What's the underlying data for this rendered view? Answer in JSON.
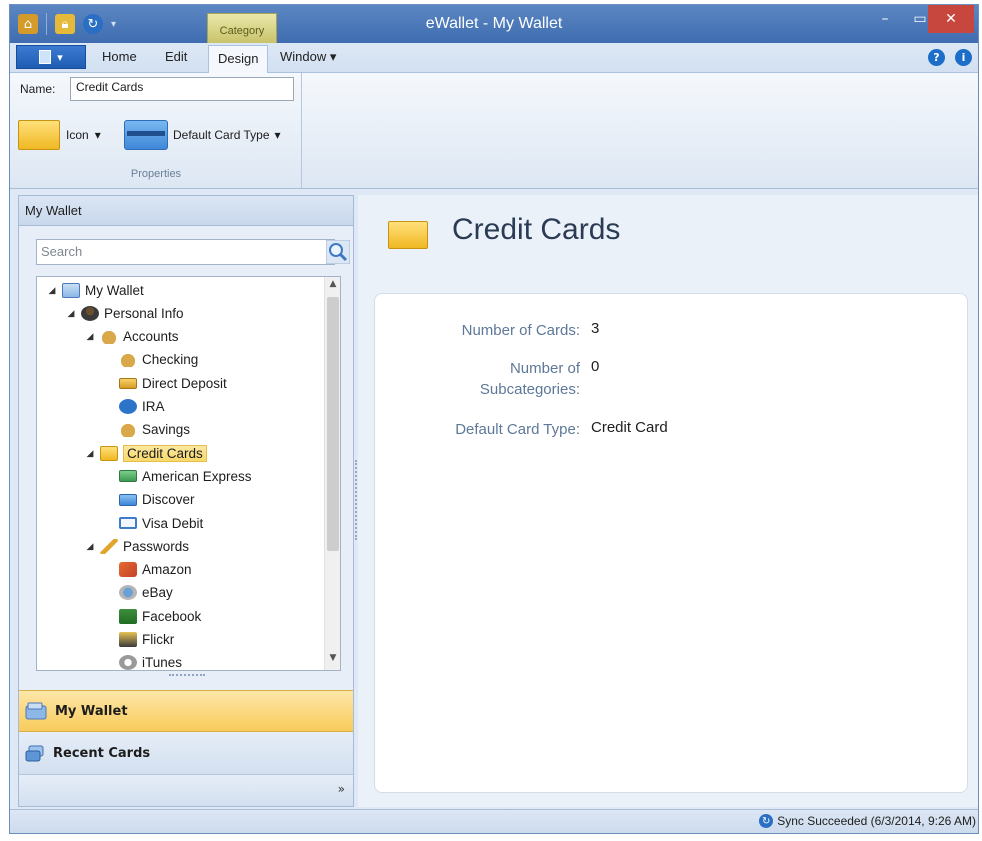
{
  "window": {
    "title": "eWallet - My Wallet",
    "context_tab": "Category"
  },
  "menu": {
    "tabs": [
      "Home",
      "Edit",
      "Design",
      "Window"
    ],
    "active_tab": "Design",
    "window_dropdown": "▾"
  },
  "ribbon": {
    "name_label": "Name:",
    "name_value": "Credit Cards",
    "icon_button": "Icon",
    "default_card_type_button": "Default Card Type",
    "group_label": "Properties"
  },
  "left_pane": {
    "header": "My Wallet",
    "search_placeholder": "Search",
    "tree": [
      {
        "label": "My Wallet",
        "icon": "wallet-icon",
        "level": 0,
        "expanded": true
      },
      {
        "label": "Personal Info",
        "icon": "person-icon",
        "level": 1,
        "expanded": true
      },
      {
        "label": "Accounts",
        "icon": "money-bag-icon",
        "level": 2,
        "expanded": true
      },
      {
        "label": "Checking",
        "icon": "money-bag-icon",
        "level": 3
      },
      {
        "label": "Direct Deposit",
        "icon": "check-icon",
        "level": 3
      },
      {
        "label": "IRA",
        "icon": "info-icon",
        "level": 3
      },
      {
        "label": "Savings",
        "icon": "money-bag-icon",
        "level": 3
      },
      {
        "label": "Credit Cards",
        "icon": "folder-icon",
        "level": 2,
        "expanded": true,
        "selected": true
      },
      {
        "label": "American Express",
        "icon": "credit-card-green-icon",
        "level": 3
      },
      {
        "label": "Discover",
        "icon": "credit-card-blue-icon",
        "level": 3
      },
      {
        "label": "Visa Debit",
        "icon": "credit-card-white-icon",
        "level": 3
      },
      {
        "label": "Passwords",
        "icon": "key-icon",
        "level": 2,
        "expanded": true
      },
      {
        "label": "Amazon",
        "icon": "amazon-icon",
        "level": 3
      },
      {
        "label": "eBay",
        "icon": "ebay-icon",
        "level": 3
      },
      {
        "label": "Facebook",
        "icon": "facebook-icon",
        "level": 3
      },
      {
        "label": "Flickr",
        "icon": "flickr-icon",
        "level": 3
      },
      {
        "label": "iTunes",
        "icon": "itunes-icon",
        "level": 3
      }
    ],
    "nav_buttons": [
      "My Wallet",
      "Recent Cards"
    ]
  },
  "right_pane": {
    "title": "Credit Cards",
    "properties": [
      {
        "label": "Number of Cards:",
        "value": "3"
      },
      {
        "label": "Number of Subcategories:",
        "label_line1": "Number of",
        "label_line2": "Subcategories:",
        "value": "0"
      },
      {
        "label": "Default Card Type:",
        "value": "Credit Card"
      }
    ]
  },
  "status": {
    "text": "Sync Succeeded (6/3/2014, 9:26 AM)"
  },
  "colors": {
    "title_bar": "#4a78b8",
    "selection": "#f8d96a",
    "label_blue": "#5d7898",
    "close_red": "#c7463d"
  }
}
